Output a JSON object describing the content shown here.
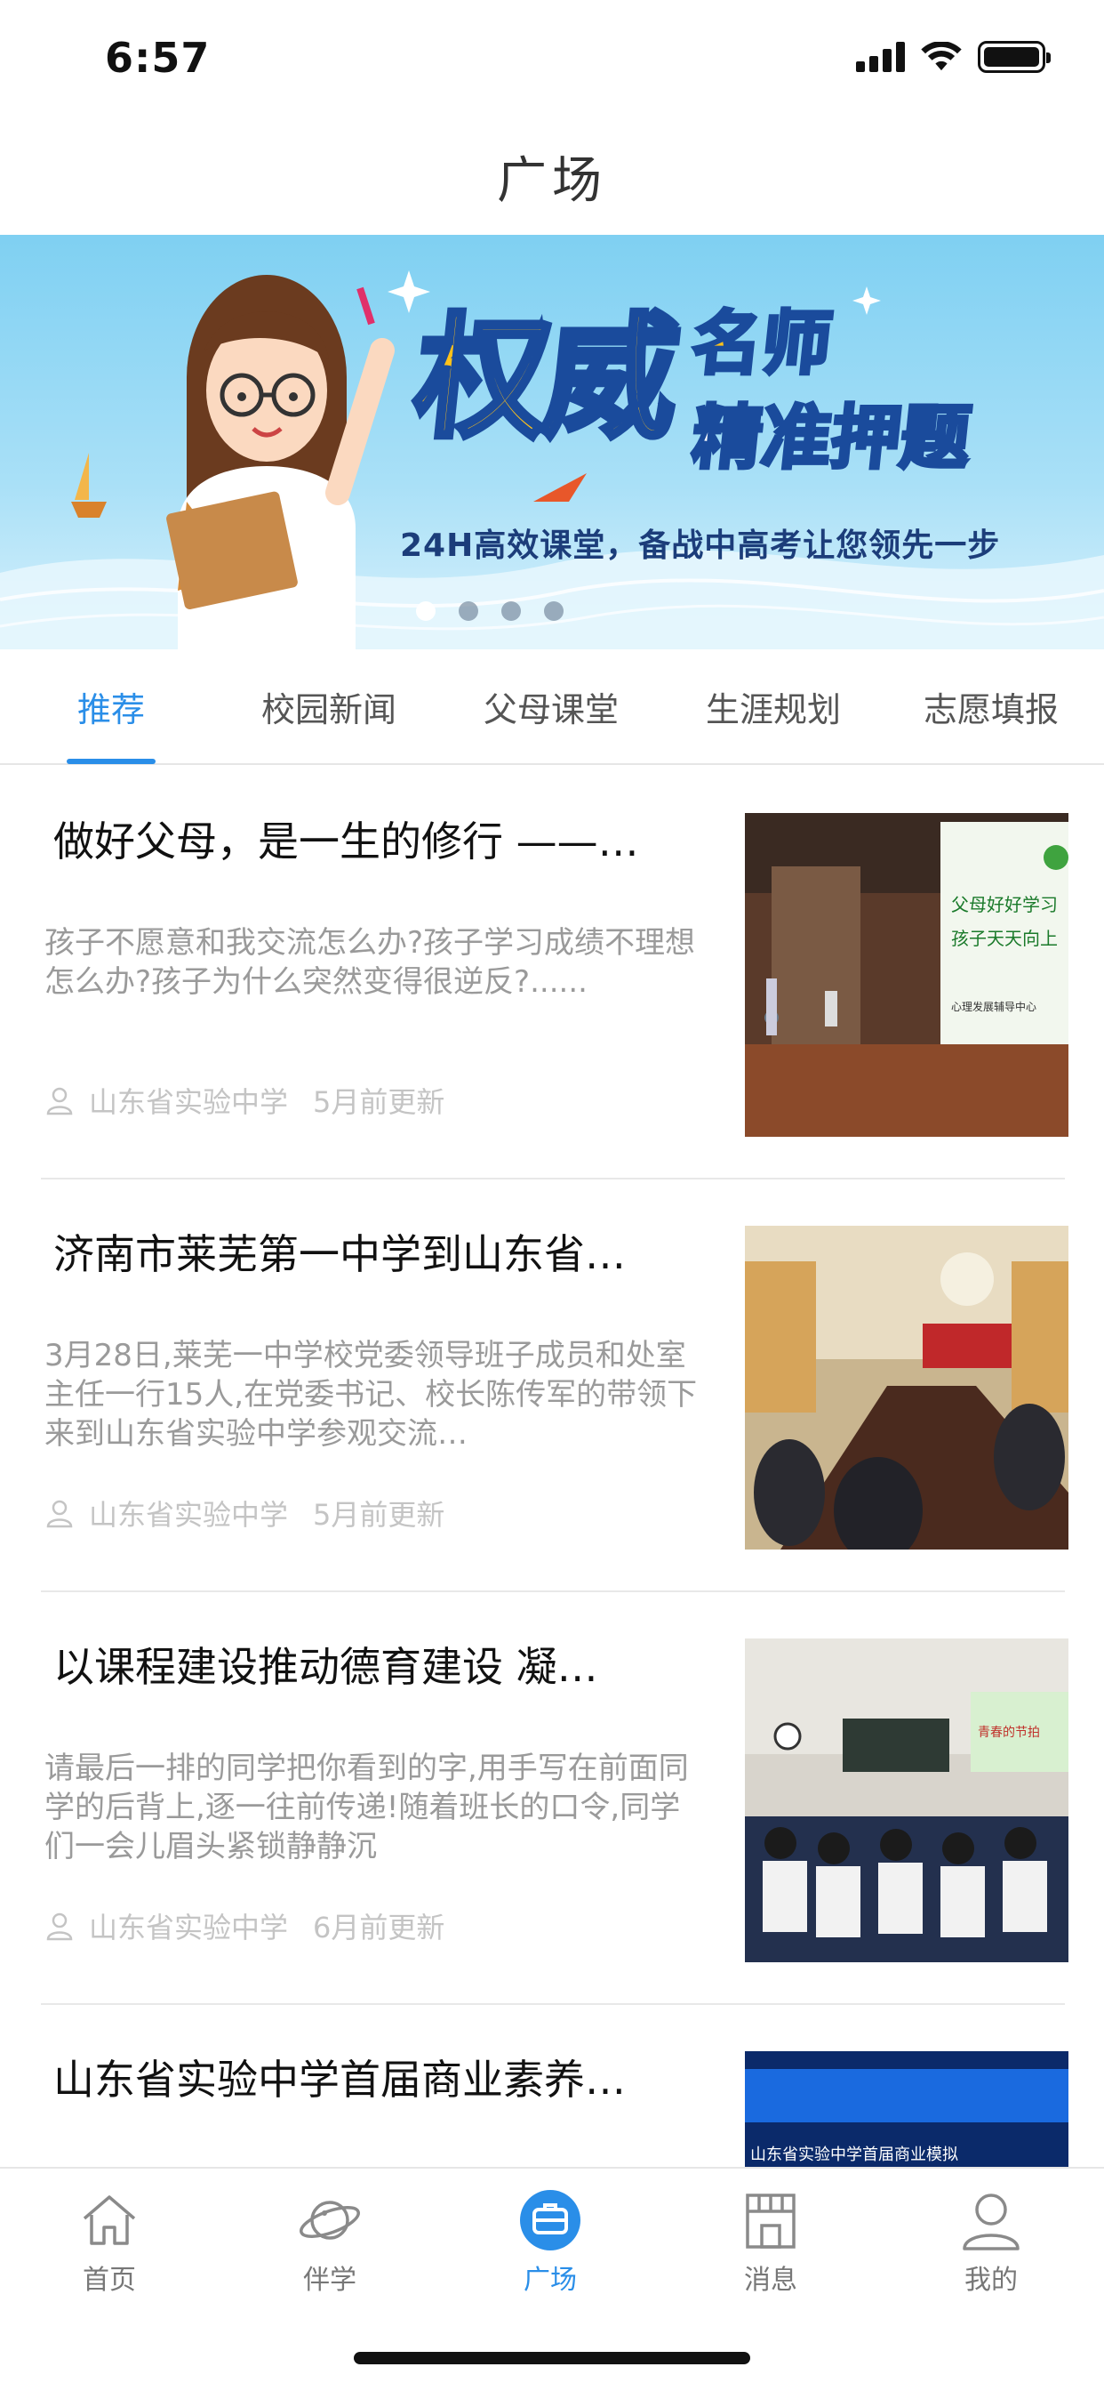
{
  "status_bar": {
    "time": "6:57"
  },
  "header": {
    "title": "广场"
  },
  "banner": {
    "headline_main": "权威",
    "headline_top": "名师",
    "headline_bottom": "精准押题",
    "tagline": "24H高效课堂，备战中高考让您领先一步",
    "slide_count": 4,
    "active_index": 0
  },
  "tabs": [
    {
      "label": "推荐",
      "active": true
    },
    {
      "label": "校园新闻",
      "active": false
    },
    {
      "label": "父母课堂",
      "active": false
    },
    {
      "label": "生涯规划",
      "active": false
    },
    {
      "label": "志愿填报",
      "active": false
    }
  ],
  "articles": [
    {
      "title": "做好父母，是一生的修行 ——…",
      "summary": "孩子不愿意和我交流怎么办?孩子学习成绩不理想怎么办?孩子为什么突然变得很逆反?......",
      "source": "山东省实验中学",
      "updated": "5月前更新",
      "image_icon": "lecture-photo",
      "image_caption_1": "父母好好学习",
      "image_caption_2": "孩子天天向上",
      "image_caption_3": "心理发展辅导中心"
    },
    {
      "title": "济南市莱芜第一中学到山东省…",
      "summary": "3月28日,莱芜一中学校党委领导班子成员和处室主任一行15人,在党委书记、校长陈传军的带领下来到山东省实验中学参观交流…",
      "source": "山东省实验中学",
      "updated": "5月前更新",
      "image_icon": "meeting-photo"
    },
    {
      "title": "以课程建设推动德育建设 凝…",
      "summary": "请最后一排的同学把你看到的字,用手写在前面同学的后背上,逐一往前传递!随着班长的口令,同学们一会儿眉头紧锁静静沉",
      "source": "山东省实验中学",
      "updated": "6月前更新",
      "image_icon": "classroom-photo",
      "image_caption_1": "青春的节拍"
    },
    {
      "title": "山东省实验中学首届商业素养…",
      "summary": "",
      "source": "",
      "updated": "",
      "image_icon": "stage-photo",
      "image_caption_1": "山东省实验中学首届商业模拟"
    }
  ],
  "tabbar": [
    {
      "label": "首页",
      "icon": "home-icon",
      "active": false
    },
    {
      "label": "伴学",
      "icon": "planet-icon",
      "active": false
    },
    {
      "label": "广场",
      "icon": "square-icon",
      "active": true
    },
    {
      "label": "消息",
      "icon": "store-icon",
      "active": false
    },
    {
      "label": "我的",
      "icon": "profile-icon",
      "active": false
    }
  ],
  "colors": {
    "accent": "#2a8ee8",
    "muted": "#9a9a9a"
  }
}
